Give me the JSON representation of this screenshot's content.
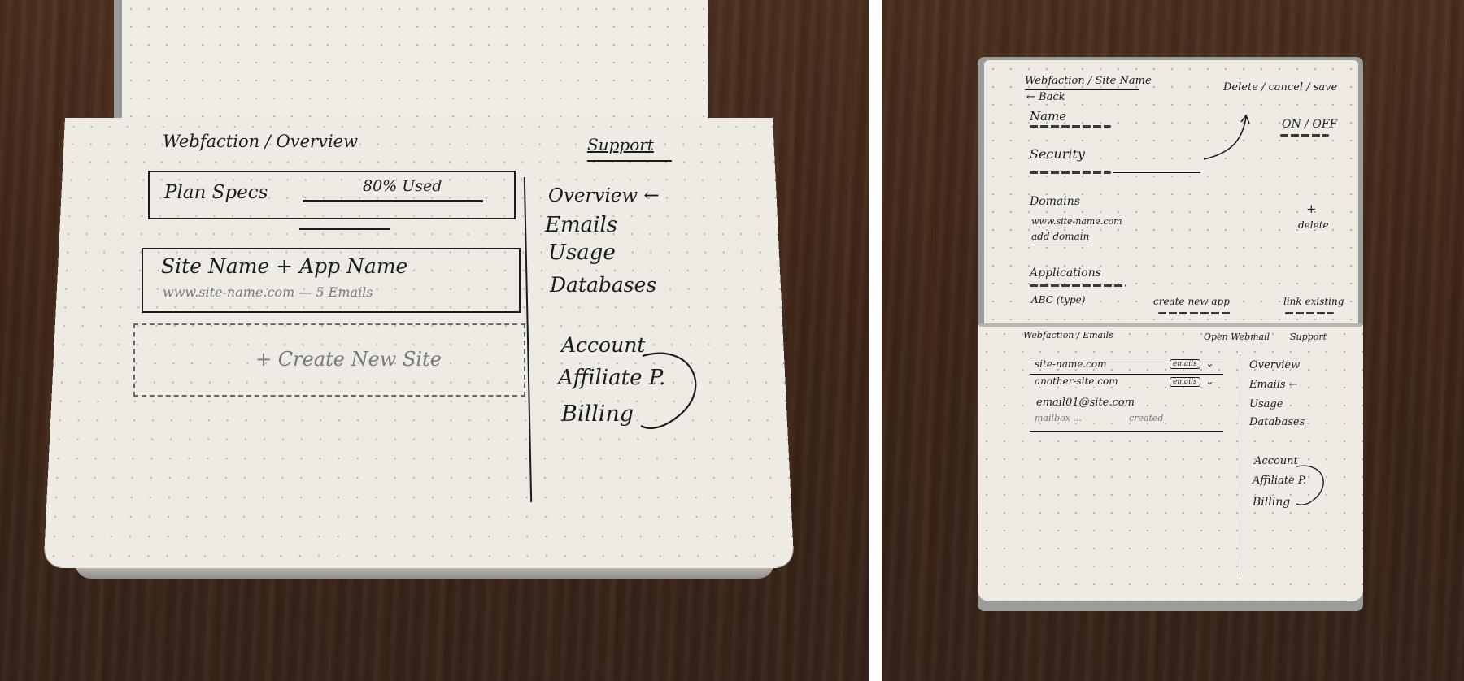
{
  "left_sketch": {
    "header": {
      "breadcrumb": "Webfaction / Overview",
      "support": "Support"
    },
    "plan_card": {
      "title": "Plan Specs",
      "usage": "80% Used"
    },
    "site_card": {
      "title": "Site Name + App Name",
      "subtitle": "www.site-name.com — 5 Emails"
    },
    "create_card": {
      "label": "+ Create New Site"
    },
    "nav": {
      "items": [
        "Overview ←",
        "Emails",
        "Usage",
        "Databases"
      ],
      "account_items": [
        "Account",
        "Affiliate P.",
        "Billing"
      ]
    }
  },
  "right_top_sketch": {
    "header": {
      "breadcrumb": "Webfaction / Site Name",
      "actions": "Delete / cancel / save"
    },
    "back": "← Back",
    "name_label": "Name",
    "toggle": "ON / OFF",
    "security_label": "Security",
    "domains": {
      "label": "Domains",
      "value": "www.site-name.com",
      "add": "+",
      "sub": "add domain",
      "delete": "delete"
    },
    "applications": {
      "label": "Applications",
      "item": "ABC (type)",
      "create": "create new app",
      "link": "link existing"
    }
  },
  "right_bottom_sketch": {
    "header": {
      "breadcrumb": "Webfaction / Emails",
      "open": "Open Webmail",
      "support": "Support"
    },
    "rows": [
      {
        "name": "site-name.com",
        "badge": "emails"
      },
      {
        "name": "another-site.com",
        "badge": "emails"
      }
    ],
    "email": {
      "address": "email01@site.com",
      "note": "mailbox ...",
      "status": "created"
    },
    "nav": {
      "items": [
        "Overview",
        "Emails ←",
        "Usage",
        "Databases"
      ],
      "account_items": [
        "Account",
        "Affiliate P.",
        "Billing"
      ]
    }
  }
}
